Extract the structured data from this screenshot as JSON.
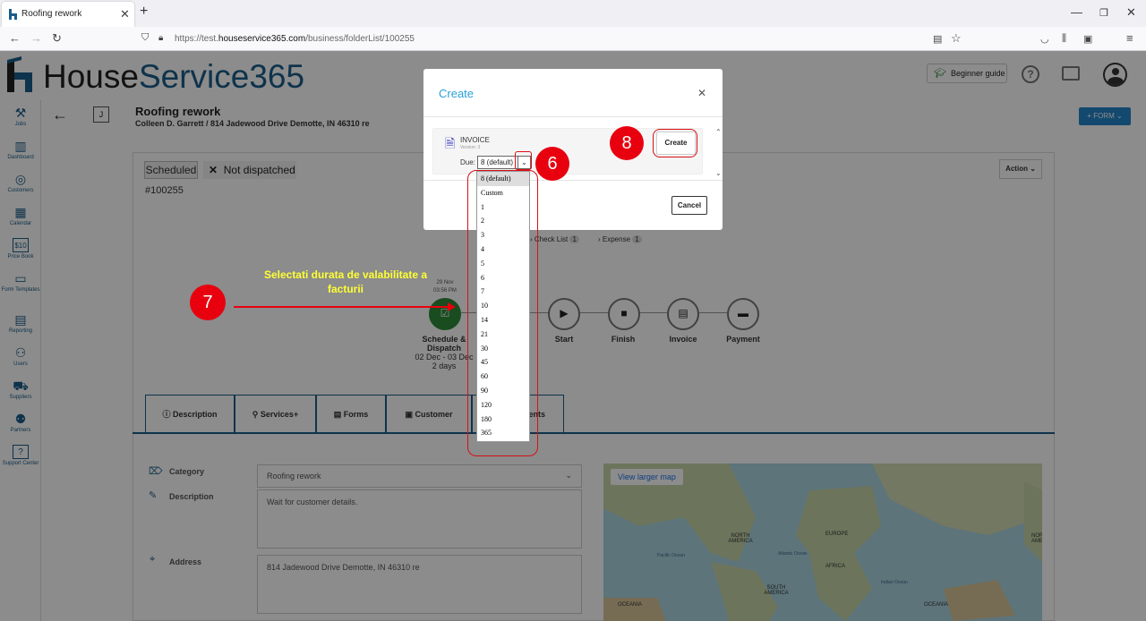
{
  "browser": {
    "tab_title": "Roofing rework",
    "url_prefix": "https://test.",
    "url_domain": "houseservice365.com",
    "url_path": "/business/folderList/100255"
  },
  "app": {
    "logo_house": "House",
    "logo_service": "Service365",
    "beginner_guide": "Beginner guide",
    "form_button": "+ FORM"
  },
  "sidebar": {
    "items": [
      {
        "label": "Jobs",
        "icon": "tools-icon"
      },
      {
        "label": "Dashboard",
        "icon": "chart-icon"
      },
      {
        "label": "Customers",
        "icon": "target-icon"
      },
      {
        "label": "Calendar",
        "icon": "calendar-icon"
      },
      {
        "label": "Price Book",
        "icon": "price-icon"
      },
      {
        "label": "Form Templates",
        "icon": "form-icon"
      },
      {
        "label": "Reporting",
        "icon": "report-icon"
      },
      {
        "label": "Users",
        "icon": "users-icon"
      },
      {
        "label": "Suppliers",
        "icon": "truck-icon"
      },
      {
        "label": "Partners",
        "icon": "partners-icon"
      },
      {
        "label": "Support Center",
        "icon": "help-icon"
      }
    ]
  },
  "job": {
    "badge": "J",
    "title": "Roofing rework",
    "subtitle": "Colleen D. Garrett / 814 Jadewood Drive Demotte, IN 46310 re",
    "status": "Scheduled",
    "dispatch": "Not dispatched",
    "number": "#100255",
    "action": "Action",
    "checklist": "Check List",
    "checklist_count": "1",
    "expense": "Expense",
    "expense_count": "1"
  },
  "timeline": {
    "date_day": "29 Nov",
    "date_time": "03:56 PM",
    "schedule_label": "Schedule &",
    "schedule_label2": "Dispatch",
    "schedule_range": "02 Dec - 03 Dec",
    "schedule_days": "2 days",
    "steps": [
      "Start",
      "Finish",
      "Invoice",
      "Payment"
    ]
  },
  "tabs": [
    "Description",
    "Services+",
    "Forms",
    "Customer",
    "ents"
  ],
  "fields": {
    "category_label": "Category",
    "category_value": "Roofing rework",
    "description_label": "Description",
    "description_value": "Wait for customer details.",
    "address_label": "Address",
    "address_value": "814 Jadewood Drive Demotte, IN 46310 re",
    "map_button": "View larger map",
    "map_labels": [
      "NORTH AMERICA",
      "EUROPE",
      "AFRICA",
      "SOUTH AMERICA",
      "OCEANIA",
      "OCEANIA",
      "NORTH AMERICA",
      "Atlantic Ocean",
      "Pacific Ocean",
      "Indian Ocean"
    ]
  },
  "modal": {
    "title": "Create",
    "doc_type": "INVOICE",
    "version": "Version: 3",
    "due_label": "Due:",
    "due_value": "8 (default)",
    "create_button": "Create",
    "cancel_button": "Cancel"
  },
  "dropdown_options": [
    "8 (default)",
    "Custom",
    "1",
    "2",
    "3",
    "4",
    "5",
    "6",
    "7",
    "10",
    "14",
    "21",
    "30",
    "45",
    "60",
    "90",
    "120",
    "180",
    "365"
  ],
  "annotations": {
    "n6": "6",
    "n7": "7",
    "n8": "8",
    "callout_line1": "Selectati durata de valabilitate a",
    "callout_line2": "facturii"
  },
  "colors": {
    "brand_blue": "#1b5d8a",
    "modal_title": "#2aa0d6",
    "annotation_red": "#e8000f",
    "callout_yellow": "#ffff33",
    "schedule_green": "#2e8b3a"
  }
}
